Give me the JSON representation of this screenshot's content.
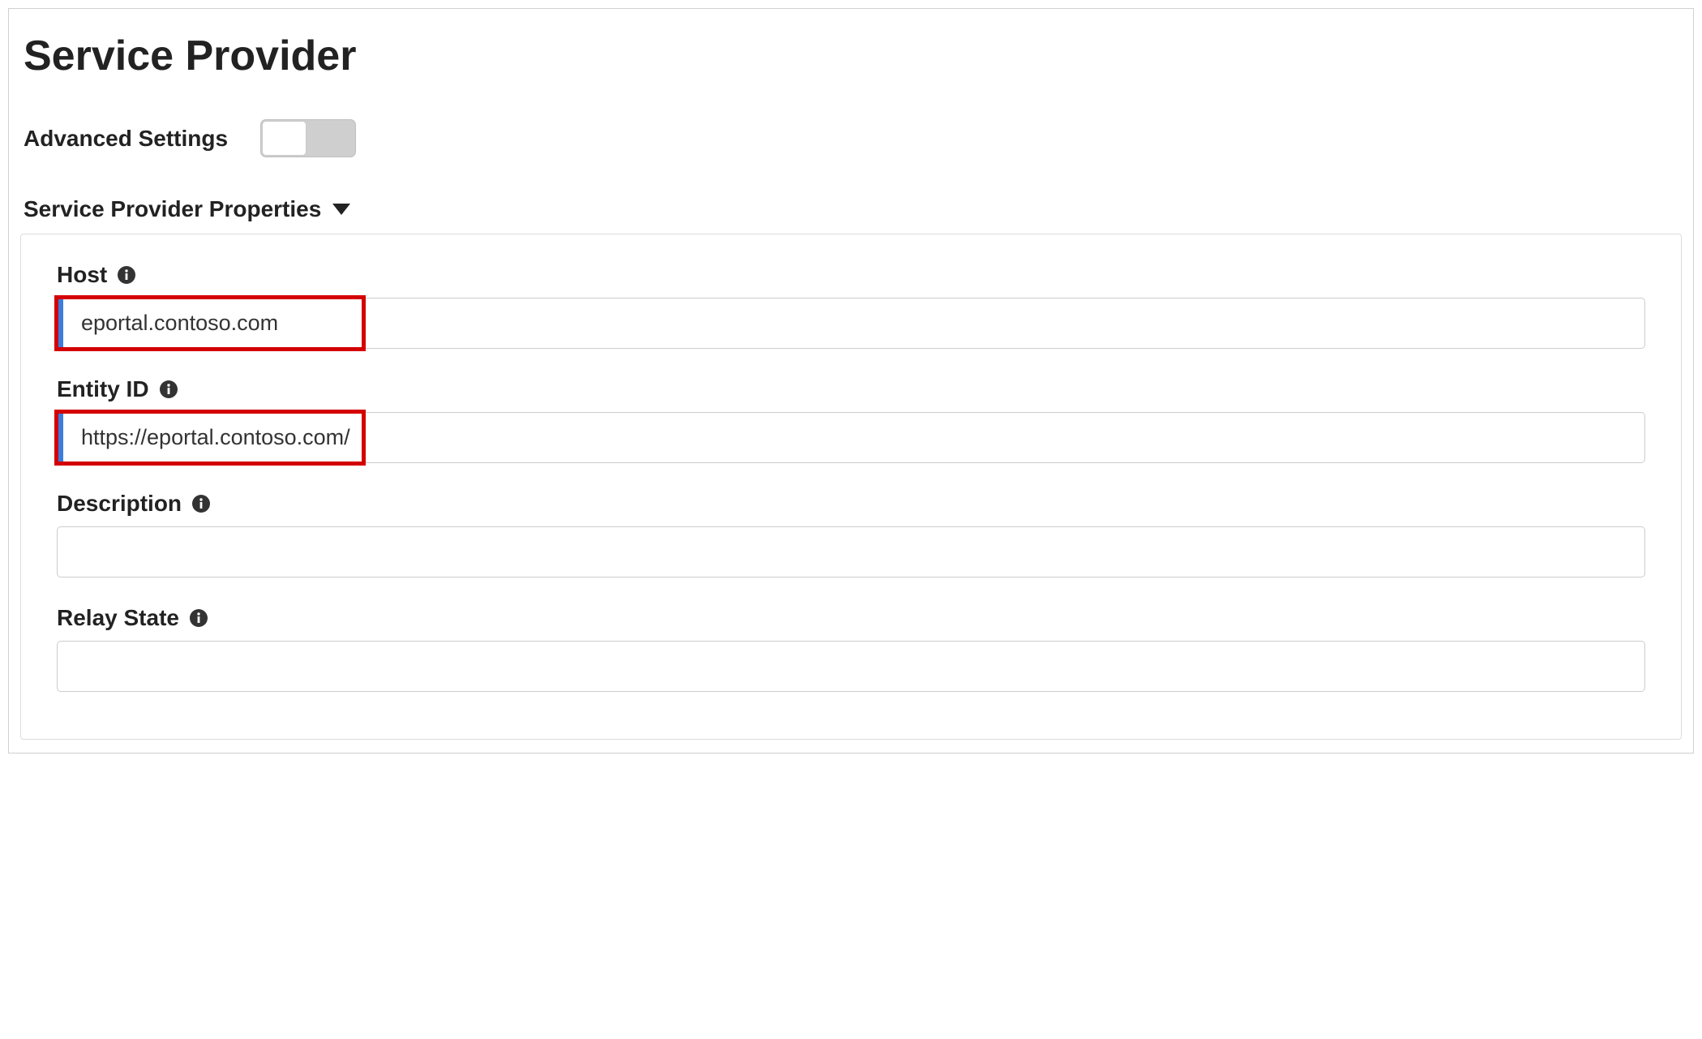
{
  "page": {
    "title": "Service Provider"
  },
  "advanced": {
    "label": "Advanced Settings"
  },
  "section": {
    "title": "Service Provider Properties"
  },
  "fields": {
    "host": {
      "label": "Host",
      "value": "eportal.contoso.com"
    },
    "entityId": {
      "label": "Entity ID",
      "value": "https://eportal.contoso.com/"
    },
    "description": {
      "label": "Description",
      "value": ""
    },
    "relayState": {
      "label": "Relay State",
      "value": ""
    }
  }
}
